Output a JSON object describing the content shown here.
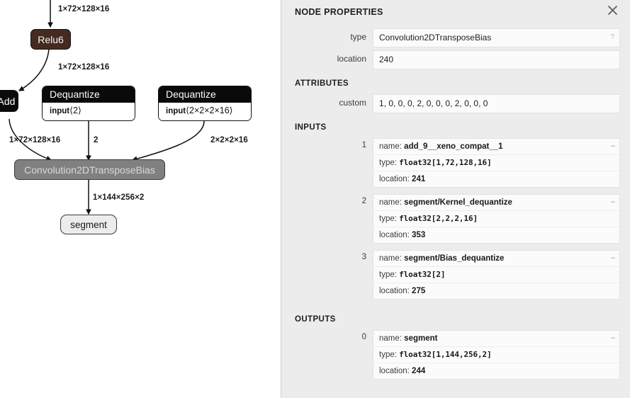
{
  "graph": {
    "nodes": [
      {
        "id": "add",
        "label": "Add",
        "kind": "op-black",
        "visible_text": "dd"
      },
      {
        "id": "relu6",
        "label": "Relu6",
        "kind": "op-brown"
      },
      {
        "id": "deq1",
        "header": "Dequantize",
        "body_key": "input",
        "body_value": "⟨2⟩",
        "kind": "two-part"
      },
      {
        "id": "deq2",
        "header": "Dequantize",
        "body_key": "input",
        "body_value": "⟨2×2×2×16⟩",
        "kind": "two-part"
      },
      {
        "id": "conv",
        "label": "Convolution2DTransposeBias",
        "kind": "op-selected"
      },
      {
        "id": "segment",
        "label": "segment",
        "kind": "io"
      }
    ],
    "edge_labels": [
      {
        "id": "e-top",
        "text": "1×72×128×16"
      },
      {
        "id": "e-relu-add",
        "text": "1×72×128×16"
      },
      {
        "id": "e-add-conv",
        "text": "1×72×128×16"
      },
      {
        "id": "e-deq1-conv",
        "text": "2"
      },
      {
        "id": "e-deq2-conv",
        "text": "2×2×2×16"
      },
      {
        "id": "e-conv-seg",
        "text": "1×144×256×2"
      }
    ],
    "colors": {
      "node_brown": "#442a20",
      "node_black": "#0a0a0a",
      "node_selected": "#808080",
      "node_selected_text": "#d9d9d9",
      "node_io": "#ececec",
      "edge": "#111111"
    }
  },
  "sidebar": {
    "title": "NODE PROPERTIES",
    "close_label": "✕",
    "properties": {
      "section_rows": [
        {
          "label": "type",
          "value": "Convolution2DTransposeBias",
          "hint": "?"
        },
        {
          "label": "location",
          "value": "240",
          "hint": ""
        }
      ]
    },
    "attributes": {
      "title": "ATTRIBUTES",
      "rows": [
        {
          "label": "custom",
          "value": "1, 0, 0, 0, 2, 0, 0, 0, 2, 0, 0, 0",
          "hint": ""
        }
      ]
    },
    "inputs": {
      "title": "INPUTS",
      "args": [
        {
          "index": "1",
          "toggle": "–",
          "name_label": "name:",
          "name_value": "add_9__xeno_compat__1",
          "type_label": "type:",
          "type_value": "float32[1,72,128,16]",
          "location_label": "location:",
          "location_value": "241"
        },
        {
          "index": "2",
          "toggle": "–",
          "name_label": "name:",
          "name_value": "segment/Kernel_dequantize",
          "type_label": "type:",
          "type_value": "float32[2,2,2,16]",
          "location_label": "location:",
          "location_value": "353"
        },
        {
          "index": "3",
          "toggle": "–",
          "name_label": "name:",
          "name_value": "segment/Bias_dequantize",
          "type_label": "type:",
          "type_value": "float32[2]",
          "location_label": "location:",
          "location_value": "275"
        }
      ]
    },
    "outputs": {
      "title": "OUTPUTS",
      "args": [
        {
          "index": "0",
          "toggle": "–",
          "name_label": "name:",
          "name_value": "segment",
          "type_label": "type:",
          "type_value": "float32[1,144,256,2]",
          "location_label": "location:",
          "location_value": "244"
        }
      ]
    }
  }
}
